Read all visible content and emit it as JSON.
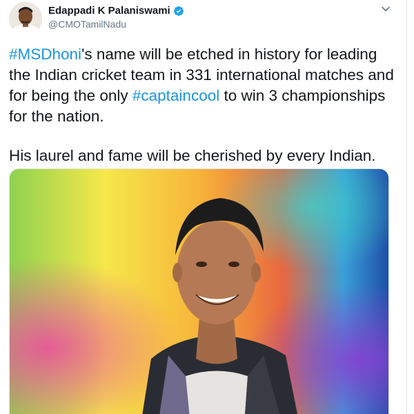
{
  "author": {
    "name": "Edappadi K Palaniswami",
    "handle": "@CMOTamilNadu",
    "verified": true
  },
  "tweet": {
    "line1_hashtag": "#MSDhoni",
    "line1_text": "'s name will be etched in history for leading the Indian cricket team in 331 international matches and for being the only ",
    "line1_hashtag2": "#captaincool",
    "line1_end": " to win 3 championships for the nation.",
    "paragraph2": "His laurel and fame will be cherished by every Indian."
  },
  "media": {
    "alt": "Portrait of MS Dhoni smiling against a colorful splash background"
  },
  "colors": {
    "link": "#1b95e0",
    "text": "#14171a",
    "secondary": "#657786",
    "verified": "#1da1f2"
  },
  "icons": {
    "menu": "chevron-down-icon",
    "verified": "verified-badge-icon"
  }
}
